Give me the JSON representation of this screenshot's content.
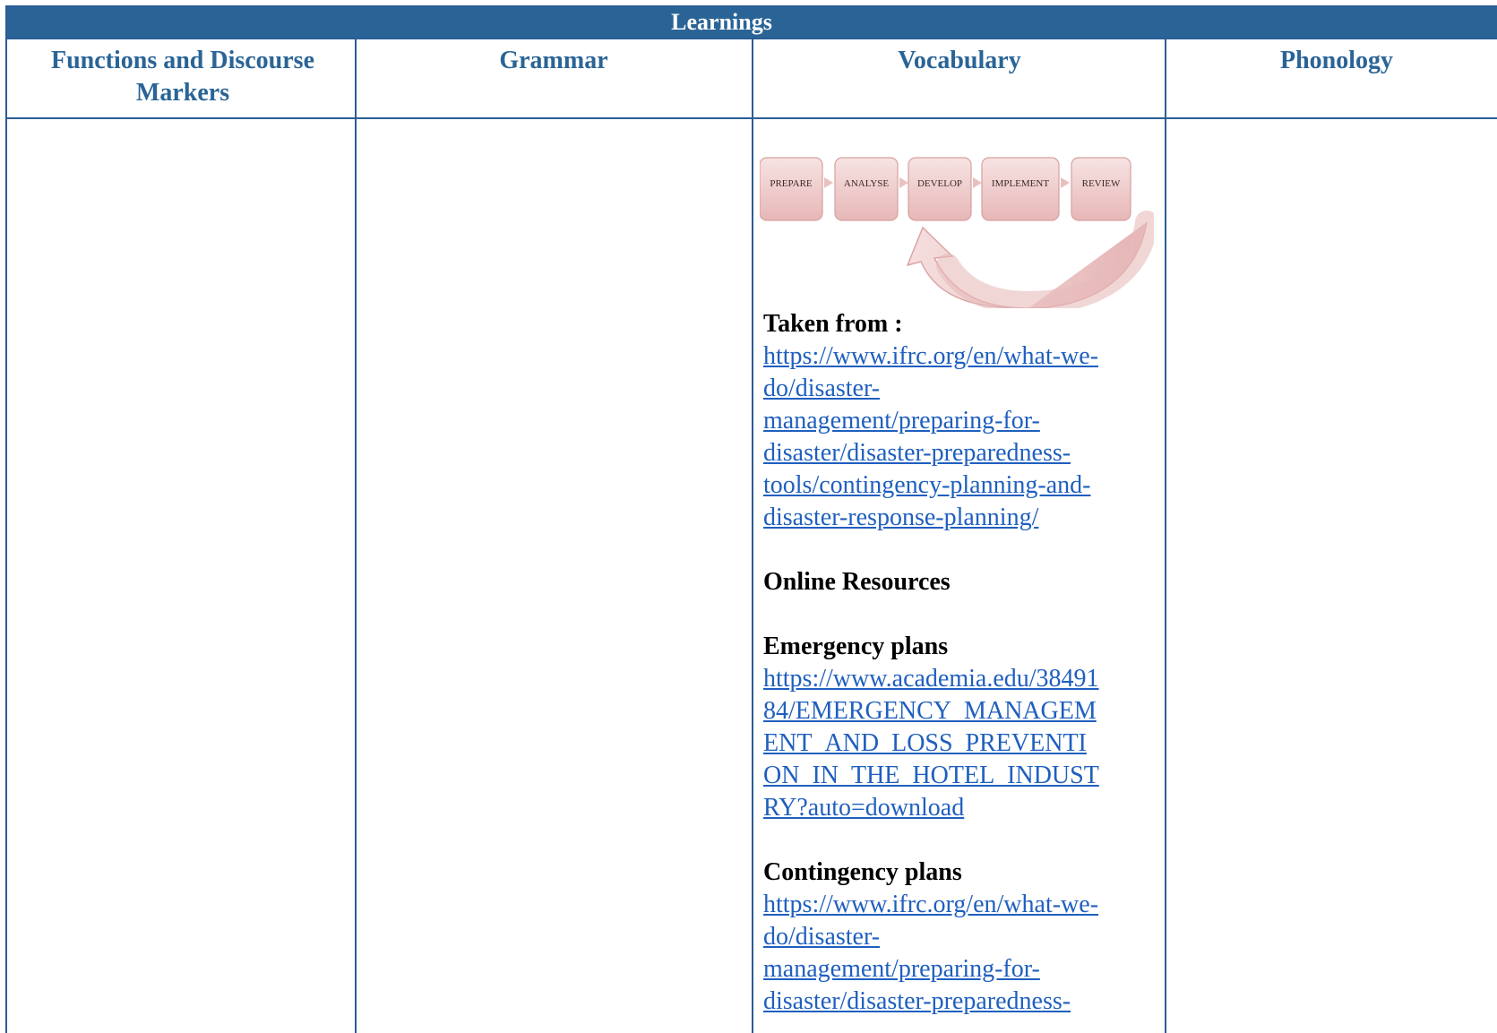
{
  "table": {
    "title": "Learnings",
    "headers": {
      "functions": "Functions and Discourse Markers",
      "functions_line1": "Functions and Discourse",
      "functions_line2": "Markers",
      "grammar": "Grammar",
      "vocabulary": "Vocabulary",
      "phonology": "Phonology"
    }
  },
  "diagram": {
    "steps": [
      "PREPARE",
      "ANALYSE",
      "DEVELOP",
      "IMPLEMENT",
      "REVIEW"
    ]
  },
  "vocabulary": {
    "taken_from_label": "Taken from :",
    "taken_from_link_lines": [
      "https://www.ifrc.org/en/what-we-",
      "do/disaster-",
      "management/preparing-for-",
      "disaster/disaster-preparedness-",
      "tools/contingency-planning-and-",
      "disaster-response-planning/"
    ],
    "online_resources_label": "Online Resources",
    "emergency_plans_label": "Emergency plans",
    "emergency_link_lines": [
      "https://www.academia.edu/38491",
      "84/EMERGENCY_MANAGEM",
      "ENT_AND_LOSS_PREVENTI",
      "ON_IN_THE_HOTEL_INDUST",
      "RY?auto=download"
    ],
    "contingency_plans_label": "Contingency plans",
    "contingency_link_lines": [
      "https://www.ifrc.org/en/what-we-",
      "do/disaster-",
      "management/preparing-for-",
      "disaster/disaster-preparedness-"
    ]
  },
  "colors": {
    "header_bg": "#2a6496",
    "header_text": "#2a6496",
    "border": "#2a5d95",
    "link": "#1f5fbf"
  }
}
